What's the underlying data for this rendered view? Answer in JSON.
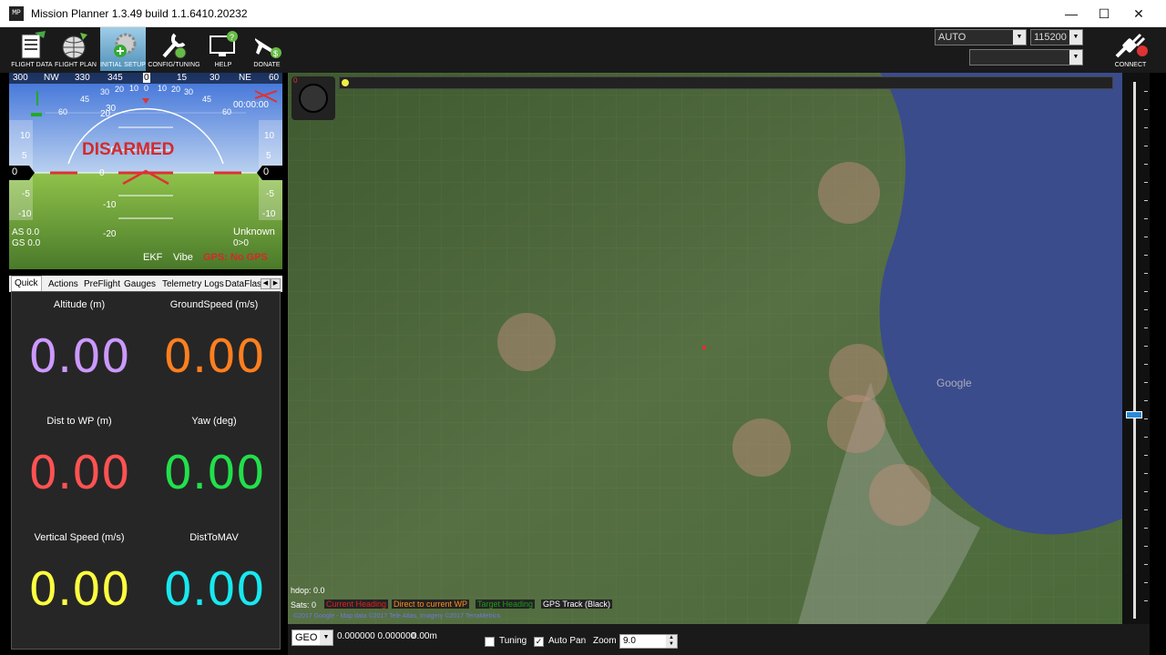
{
  "window": {
    "title": "Mission Planner 1.3.49 build 1.1.6410.20232",
    "minimize": "—",
    "maximize": "☐",
    "close": "✕"
  },
  "toolbar": {
    "buttons": [
      {
        "label": "FLIGHT DATA",
        "icon": "clipboard-icon"
      },
      {
        "label": "FLIGHT PLAN",
        "icon": "globe-icon"
      },
      {
        "label": "INITIAL SETUP",
        "icon": "gear-plus-icon"
      },
      {
        "label": "CONFIG/TUNING",
        "icon": "wrench-icon"
      },
      {
        "label": "HELP",
        "icon": "monitor-help-icon"
      },
      {
        "label": "DONATE",
        "icon": "plane-dollar-icon"
      }
    ],
    "mode_select": "AUTO",
    "baud_select": "115200",
    "port_select": "",
    "connect_label": "CONNECT"
  },
  "hud": {
    "status": "DISARMED",
    "heading_ticks": [
      "300",
      "NW",
      "330",
      "345",
      "0",
      "15",
      "30",
      "NE",
      "60"
    ],
    "pitch_labels": [
      "30",
      "20",
      "10",
      "0",
      "-10",
      "-20"
    ],
    "roll_labels": [
      "60",
      "45",
      "30",
      "20",
      "10",
      "0",
      "10",
      "20",
      "30",
      "45",
      "60"
    ],
    "alt_scale": [
      "10",
      "5",
      "0",
      "-5",
      "-10"
    ],
    "speed_scale": [
      "10",
      "5",
      "0",
      "-5",
      "-10"
    ],
    "left_readout": "0",
    "right_readout": "0",
    "airspeed": "AS 0.0",
    "groundspeed": "GS 0.0",
    "timer": "00:00:00",
    "mode_text": "Unknown",
    "ratio": "0>0",
    "ekf": "EKF",
    "vibe": "Vibe",
    "gps": "GPS: No GPS"
  },
  "tabs": {
    "items": [
      "Quick",
      "Actions",
      "PreFlight",
      "Gauges",
      "Telemetry Logs",
      "DataFlash"
    ],
    "active": "Quick"
  },
  "quick": [
    {
      "label": "Altitude (m)",
      "value": "0.00",
      "color": "#cc99ff"
    },
    {
      "label": "GroundSpeed (m/s)",
      "value": "0.00",
      "color": "#ff7f1f"
    },
    {
      "label": "Dist to WP (m)",
      "value": "0.00",
      "color": "#ff5252"
    },
    {
      "label": "Yaw (deg)",
      "value": "0.00",
      "color": "#22e04a"
    },
    {
      "label": "Vertical Speed (m/s)",
      "value": "0.00",
      "color": "#ffff40"
    },
    {
      "label": "DistToMAV",
      "value": "0.00",
      "color": "#18e8f0"
    }
  ],
  "map": {
    "hdop": "hdop: 0.0",
    "sats": "Sats: 0",
    "legend": [
      {
        "label": "Current Heading",
        "color": "#e02020"
      },
      {
        "label": "Direct to current WP",
        "color": "#ff8c1a"
      },
      {
        "label": "Target Heading",
        "color": "#1a9a1a"
      },
      {
        "label": "GPS Track (Black)",
        "color": "#ffffff"
      }
    ],
    "copyright": "©2017 Google - Map data ©2017 Tele Atlas, Imagery ©2017 TerraMetrics",
    "watermark": "Google"
  },
  "statusbar": {
    "coord_mode": "GEO",
    "coords": "0.000000 0.000000",
    "alt": "0.00m",
    "tuning_label": "Tuning",
    "tuning_checked": false,
    "autopan_label": "Auto Pan",
    "autopan_checked": true,
    "zoom_label": "Zoom",
    "zoom_value": "9.0"
  }
}
